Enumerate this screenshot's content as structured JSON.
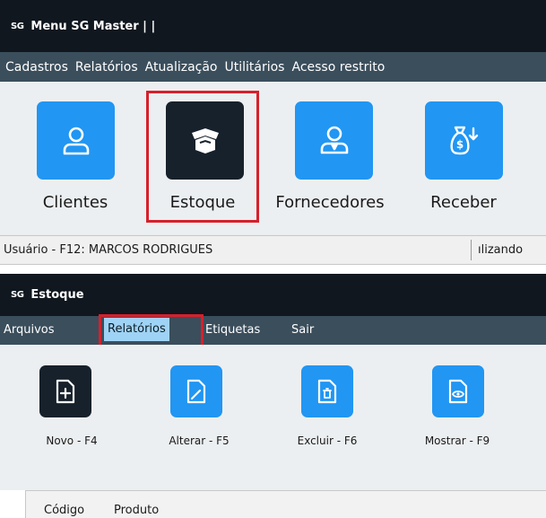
{
  "win1": {
    "sg": "SG",
    "title": "Menu SG Master | |",
    "menu": [
      "Cadastros",
      "Relatórios",
      "Atualização",
      "Utilitários",
      "Acesso restrito"
    ],
    "tiles": [
      {
        "label": "Clientes",
        "icon": "user-icon"
      },
      {
        "label": "Estoque",
        "icon": "box-icon"
      },
      {
        "label": "Fornecedores",
        "icon": "supplier-icon"
      },
      {
        "label": "Receber",
        "icon": "money-bag-icon"
      }
    ],
    "status_user": "Usuário - F12: MARCOS RODRIGUES",
    "status_right": "ılizando"
  },
  "win2": {
    "sg": "SG",
    "title": "Estoque",
    "menu": [
      "Arquivos",
      "Relatórios",
      "Etiquetas",
      "Sair"
    ],
    "tiles": [
      {
        "label": "Novo - F4",
        "icon": "new-file-icon"
      },
      {
        "label": "Alterar - F5",
        "icon": "edit-file-icon"
      },
      {
        "label": "Excluir - F6",
        "icon": "delete-file-icon"
      },
      {
        "label": "Mostrar - F9",
        "icon": "view-file-icon"
      }
    ],
    "columns": [
      "Código",
      "Produto"
    ]
  },
  "colors": {
    "accent_blue": "#2196f3",
    "dark_tile": "#17212b",
    "highlight_red": "#d7202b",
    "selected_menu": "#9fd3f5"
  }
}
